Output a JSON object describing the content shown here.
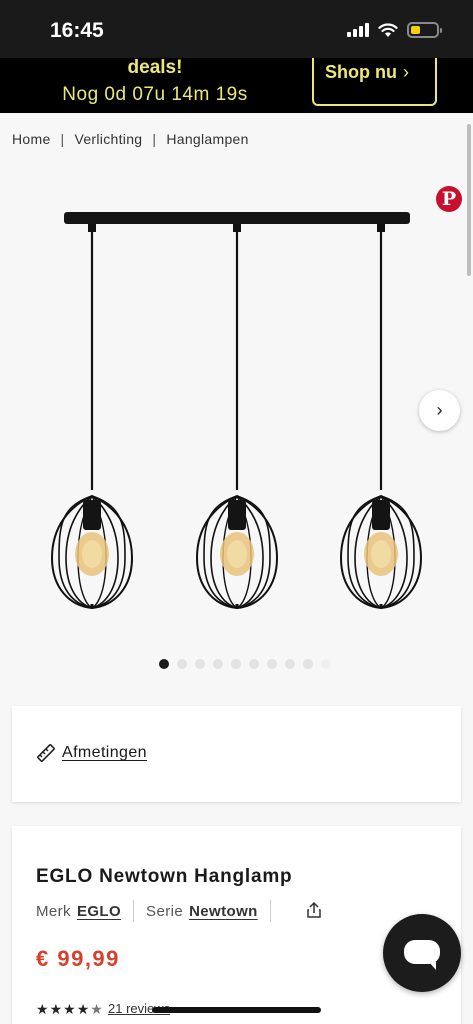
{
  "status_bar": {
    "time": "16:45",
    "icons": [
      "signal-icon",
      "wifi-icon",
      "battery-icon"
    ],
    "battery_color": "#f5d10a"
  },
  "promo": {
    "title": "deals!",
    "countdown": "Nog 0d 07u 14m 19s",
    "button_label": "Shop nu",
    "accent_color": "#ede77a"
  },
  "breadcrumb": {
    "items": [
      "Home",
      "Verlichting",
      "Hanglampen"
    ],
    "separator": "|"
  },
  "gallery": {
    "pinterest_label": "P",
    "dots_total": 10,
    "active_dot_index": 0
  },
  "dimensions": {
    "label": "Afmetingen"
  },
  "product": {
    "title": "EGLO Newtown Hanglamp",
    "brand_label": "Merk",
    "brand": "EGLO",
    "series_label": "Serie",
    "series": "Newtown",
    "price": "€ 99,99",
    "price_color": "#d9402b",
    "rating": 4.5,
    "rating_max": 5,
    "reviews": "21 reviews"
  }
}
